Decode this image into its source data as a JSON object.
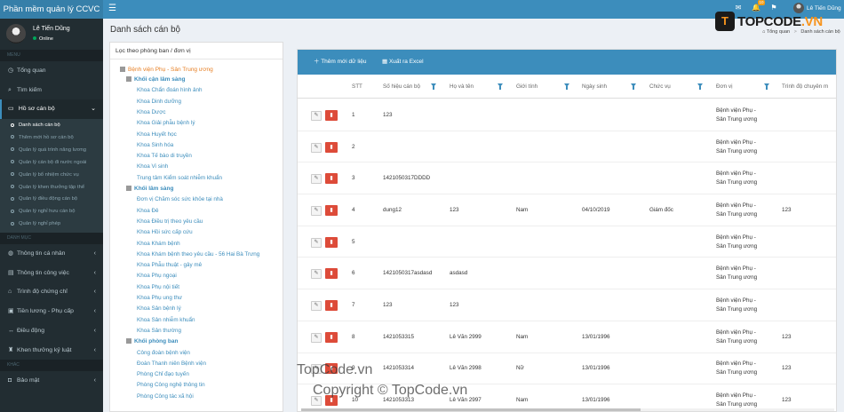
{
  "app": {
    "title": "Phần mềm quản lý CCVC",
    "menu_icon": "hamburger-icon"
  },
  "topbar": {
    "icons": [
      {
        "name": "envelope-icon",
        "glyph": "✉",
        "badge": "",
        "badge_color": "#00a65a"
      },
      {
        "name": "bell-icon",
        "glyph": "🔔",
        "badge": "10",
        "badge_color": "#f39c12"
      },
      {
        "name": "flag-icon",
        "glyph": "⚑",
        "badge": "",
        "badge_color": "#dd4b39"
      }
    ],
    "user_name": "Lê Tiến Dũng"
  },
  "logo": {
    "mark": "T",
    "text_main": "TOPCODE",
    "text_accent": ".VN"
  },
  "sidebar": {
    "user_name": "Lê Tiến Dũng",
    "status": "Online",
    "menu_header": "MENU",
    "items_top": [
      {
        "icon": "dashboard-icon",
        "glyph": "◷",
        "label": "Tổng quan"
      },
      {
        "icon": "search-icon",
        "glyph": "⌕",
        "label": "Tìm kiếm"
      }
    ],
    "active_item": {
      "icon": "folder-icon",
      "glyph": "▭",
      "label": "Hồ sơ cán bộ"
    },
    "sub_items": [
      "Danh sách cán bộ",
      "Thêm mới hồ sơ cán bộ",
      "Quản lý quá trình nâng lương",
      "Quản lý cán bộ đi nước ngoài",
      "Quản lý bổ nhiệm chức vụ",
      "Quản lý khen thưởng tập thể",
      "Quản lý điều động cán bộ",
      "Quản lý nghỉ hưu cán bộ",
      "Quản lý nghỉ phép"
    ],
    "catalog_header": "DANH MỤC",
    "catalog_items": [
      {
        "icon": "globe-icon",
        "glyph": "◍",
        "label": "Thông tin cá nhân"
      },
      {
        "icon": "briefcase-icon",
        "glyph": "▤",
        "label": "Thông tin công việc"
      },
      {
        "icon": "graduation-icon",
        "glyph": "⌂",
        "label": "Trình độ chứng chỉ"
      },
      {
        "icon": "money-icon",
        "glyph": "▣",
        "label": "Tiền lương - Phụ cấp"
      },
      {
        "icon": "arrows-icon",
        "glyph": "↔",
        "label": "Điều động"
      },
      {
        "icon": "trophy-icon",
        "glyph": "♜",
        "label": "Khen thưởng kỷ luật"
      }
    ],
    "other_header": "KHÁC",
    "other_items": [
      {
        "icon": "lock-icon",
        "glyph": "◘",
        "label": "Bảo mật"
      }
    ]
  },
  "page": {
    "title": "Danh sách cán bộ",
    "breadcrumb_home": "Tổng quan",
    "breadcrumb_current": "Danh sách cán bộ"
  },
  "tree": {
    "title": "Lọc theo phòng ban / đơn vị",
    "root": "Bệnh viện Phụ - Sản Trung ương",
    "groups": [
      {
        "label": "Khối cận lâm sàng",
        "leaves": [
          "Khoa Chẩn đoán hình ảnh",
          "Khoa Dinh dưỡng",
          "Khoa Dược",
          "Khoa Giải phẫu bệnh lý",
          "Khoa Huyết học",
          "Khoa Sinh hóa",
          "Khoa Tế bào di truyền",
          "Khoa Vi sinh",
          "Trung tâm Kiểm soát nhiễm khuẩn"
        ]
      },
      {
        "label": "Khối lâm sàng",
        "leaves": [
          "Đơn vị Chăm sóc sức khỏe tại nhà",
          "Khoa Đẻ",
          "Khoa Điều trị theo yêu cầu",
          "Khoa Hồi sức cấp cứu",
          "Khoa Khám bệnh",
          "Khoa Khám bệnh theo yêu cầu - 56 Hai Bà Trưng",
          "Khoa Phẫu thuật - gây mê",
          "Khoa Phụ ngoại",
          "Khoa Phụ nội tiết",
          "Khoa Phụ ung thư",
          "Khoa Sản bệnh lý",
          "Khoa Sản nhiễm khuẩn",
          "Khoa Sản thường"
        ]
      },
      {
        "label": "Khối phòng ban",
        "leaves": [
          "Công đoàn bệnh viện",
          "Đoàn Thanh niên Bệnh viện",
          "Phòng Chỉ đạo tuyến",
          "Phòng Công nghệ thông tin",
          "Phòng Công tác xã hội"
        ]
      }
    ]
  },
  "table": {
    "add_button": "Thêm mới dữ liệu",
    "export_button": "Xuất ra Excel",
    "columns": [
      "STT",
      "Số hiệu cán bộ",
      "Họ và tên",
      "Giới tính",
      "Ngày sinh",
      "Chức vụ",
      "Đơn vị",
      "Trình độ chuyên m"
    ],
    "rows": [
      {
        "stt": "1",
        "code": "123",
        "name": "",
        "gender": "",
        "dob": "",
        "position": "",
        "unit1": "Bệnh viện Phụ -",
        "unit2": "Sản Trung ương",
        "level": ""
      },
      {
        "stt": "2",
        "code": "",
        "name": "",
        "gender": "",
        "dob": "",
        "position": "",
        "unit1": "Bệnh viện Phụ -",
        "unit2": "Sản Trung ương",
        "level": ""
      },
      {
        "stt": "3",
        "code": "1421050317DDDD",
        "name": "",
        "gender": "",
        "dob": "",
        "position": "",
        "unit1": "Bệnh viện Phụ -",
        "unit2": "Sản Trung ương",
        "level": ""
      },
      {
        "stt": "4",
        "code": "dung12",
        "name": "123",
        "gender": "Nam",
        "dob": "04/10/2019",
        "position": "Giám đốc",
        "unit1": "Bệnh viện Phụ -",
        "unit2": "Sản Trung ương",
        "level": "123"
      },
      {
        "stt": "5",
        "code": "",
        "name": "",
        "gender": "",
        "dob": "",
        "position": "",
        "unit1": "Bệnh viện Phụ -",
        "unit2": "Sản Trung ương",
        "level": ""
      },
      {
        "stt": "6",
        "code": "1421050317asdasd",
        "name": "asdasd",
        "gender": "",
        "dob": "",
        "position": "",
        "unit1": "Bệnh viện Phụ -",
        "unit2": "Sản Trung ương",
        "level": ""
      },
      {
        "stt": "7",
        "code": "123",
        "name": "123",
        "gender": "",
        "dob": "",
        "position": "",
        "unit1": "Bệnh viện Phụ -",
        "unit2": "Sản Trung ương",
        "level": ""
      },
      {
        "stt": "8",
        "code": "1421053315",
        "name": "Lê Văn 2999",
        "gender": "Nam",
        "dob": "13/01/1996",
        "position": "",
        "unit1": "Bệnh viện Phụ -",
        "unit2": "Sản Trung ương",
        "level": "123"
      },
      {
        "stt": "9",
        "code": "1421053314",
        "name": "Lê Văn 2998",
        "gender": "Nữ",
        "dob": "13/01/1996",
        "position": "",
        "unit1": "Bệnh viện Phụ -",
        "unit2": "Sản Trung ương",
        "level": "123"
      },
      {
        "stt": "10",
        "code": "1421053313",
        "name": "Lê Văn 2997",
        "gender": "Nam",
        "dob": "13/01/1996",
        "position": "",
        "unit1": "Bệnh viện Phụ -",
        "unit2": "Sản Trung ương",
        "level": "123"
      }
    ]
  },
  "watermark": {
    "line1": "TopCode.vn",
    "line2": "Copyright © TopCode.vn"
  }
}
